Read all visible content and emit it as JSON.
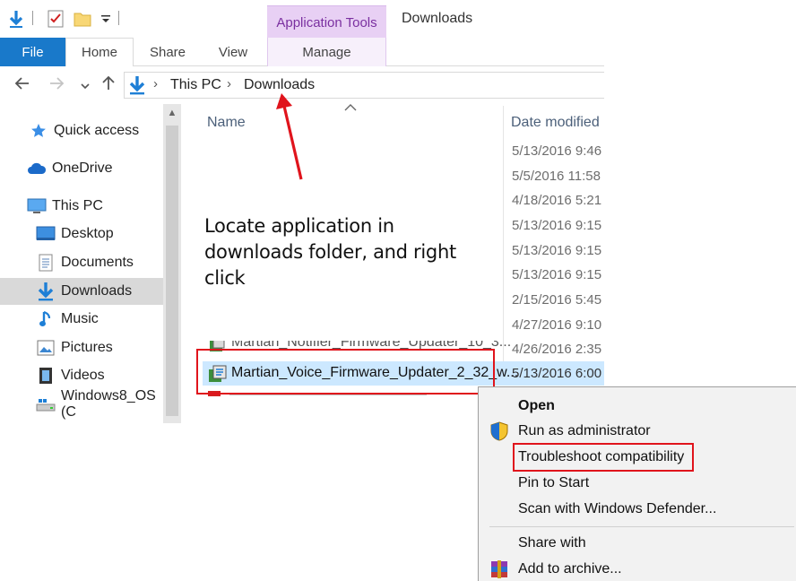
{
  "window": {
    "title": "Downloads",
    "contextual_tab_group": "Application Tools"
  },
  "ribbon": {
    "tabs": [
      {
        "label": "File"
      },
      {
        "label": "Home"
      },
      {
        "label": "Share"
      },
      {
        "label": "View"
      },
      {
        "label": "Manage"
      }
    ]
  },
  "address_bar": {
    "crumbs": [
      "This PC",
      "Downloads"
    ]
  },
  "nav_pane": {
    "items": [
      {
        "label": "Quick access",
        "icon": "star-icon"
      },
      {
        "label": "OneDrive",
        "icon": "cloud-icon"
      },
      {
        "label": "This PC",
        "icon": "computer-icon"
      },
      {
        "label": "Desktop",
        "icon": "desktop-icon"
      },
      {
        "label": "Documents",
        "icon": "documents-icon"
      },
      {
        "label": "Downloads",
        "icon": "download-arrow-icon",
        "selected": true
      },
      {
        "label": "Music",
        "icon": "music-note-icon"
      },
      {
        "label": "Pictures",
        "icon": "pictures-icon"
      },
      {
        "label": "Videos",
        "icon": "film-icon"
      },
      {
        "label": "Windows8_OS (C",
        "icon": "drive-icon"
      }
    ]
  },
  "file_list": {
    "columns": {
      "name": "Name",
      "date": "Date modified"
    },
    "dates": [
      "5/13/2016 9:46",
      "5/5/2016 11:58",
      "4/18/2016 5:21",
      "5/13/2016 9:15",
      "5/13/2016 9:15",
      "5/13/2016 9:15",
      "2/15/2016 5:45",
      "4/27/2016 9:10",
      "4/26/2016 2:35",
      "5/13/2016 6:00"
    ],
    "partial_file": "Martian_Notifier_Firmware_Updater_10_3...",
    "selected_file": "Martian_Voice_Firmware_Updater_2_32_w..."
  },
  "annotation": {
    "text": "Locate application in downloads folder, and right click"
  },
  "context_menu": {
    "items": [
      {
        "label": "Open",
        "bold": true
      },
      {
        "label": "Run as administrator",
        "icon": "uac-shield-icon"
      },
      {
        "label": "Troubleshoot compatibility",
        "highlighted": true
      },
      {
        "label": "Pin to Start"
      },
      {
        "label": "Scan with Windows Defender..."
      },
      {
        "label": "Share with"
      },
      {
        "label": "Add to archive...",
        "icon": "winrar-icon"
      }
    ]
  },
  "colors": {
    "file_tab": "#1979ca",
    "app_tools": "#e8d0f4",
    "selection": "#cce8ff",
    "annotation_red": "#e0141c"
  }
}
